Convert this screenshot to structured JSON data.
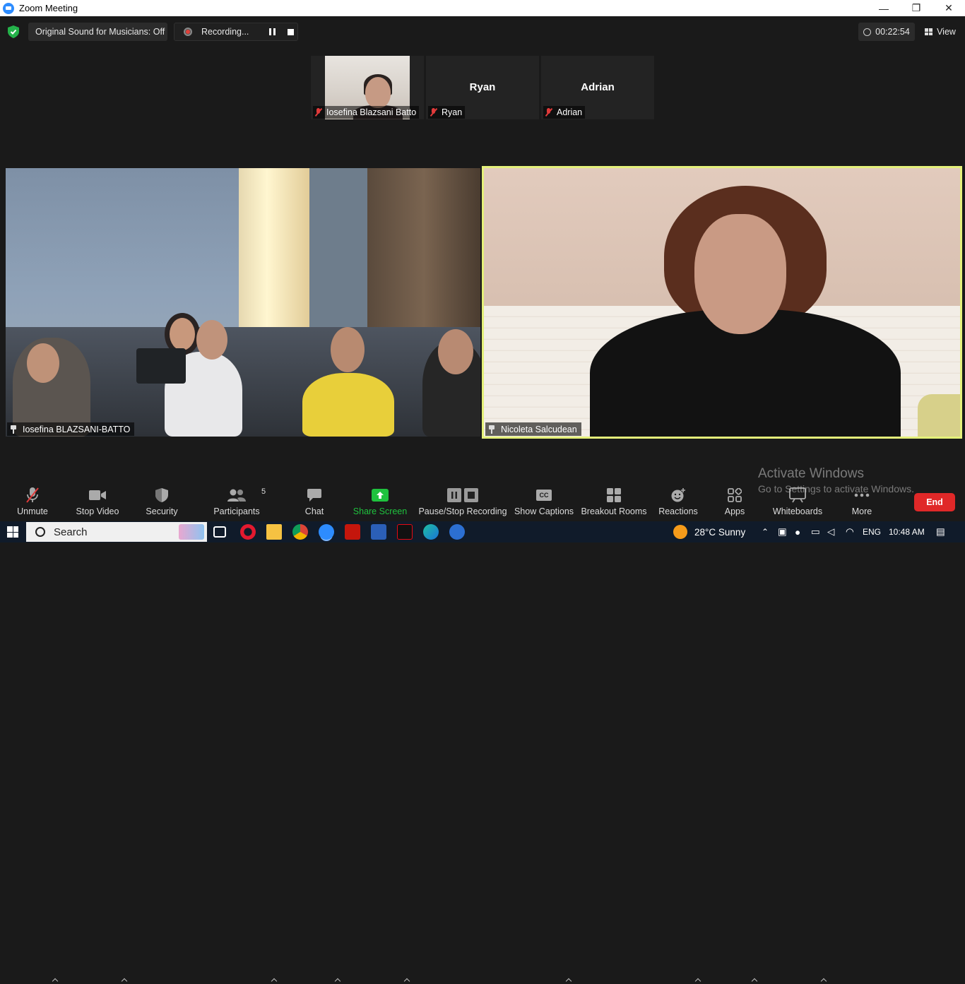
{
  "window": {
    "title": "Zoom Meeting",
    "controls": {
      "minimize": "—",
      "restore": "❐",
      "close": "✕"
    }
  },
  "topbar": {
    "original_sound": "Original Sound for Musicians: Off",
    "recording": "Recording...",
    "timer": "00:22:54",
    "view": "View"
  },
  "thumbnails": [
    {
      "big_name": "",
      "name": "Iosefina Blazsani Batto",
      "video_on": true
    },
    {
      "big_name": "Ryan",
      "name": "Ryan",
      "video_on": false
    },
    {
      "big_name": "Adrian",
      "name": "Adrian",
      "video_on": false
    }
  ],
  "main_tiles": [
    {
      "name": "Iosefina BLAZSANI-BATTO"
    },
    {
      "name": "Nicoleta Salcudean",
      "active_speaker": true
    }
  ],
  "watermark": {
    "line1": "Activate Windows",
    "line2": "Go to Settings to activate Windows."
  },
  "toolbar": {
    "unmute": "Unmute",
    "stop_video": "Stop Video",
    "security": "Security",
    "participants": "Participants",
    "participants_count": "5",
    "chat": "Chat",
    "share_screen": "Share Screen",
    "pause_stop_recording": "Pause/Stop Recording",
    "show_captions": "Show Captions",
    "captions_badge": "CC",
    "breakout_rooms": "Breakout Rooms",
    "reactions": "Reactions",
    "apps": "Apps",
    "whiteboards": "Whiteboards",
    "more": "More",
    "end": "End"
  },
  "taskbar": {
    "search": "Search",
    "weather": "28°C  Sunny",
    "language": "ENG",
    "time": "10:48 AM"
  },
  "colors": {
    "share_green": "#1fc23e",
    "active_speaker_border": "#e4f07a",
    "end_red": "#e02828",
    "mic_off_red": "#e03a3a"
  }
}
